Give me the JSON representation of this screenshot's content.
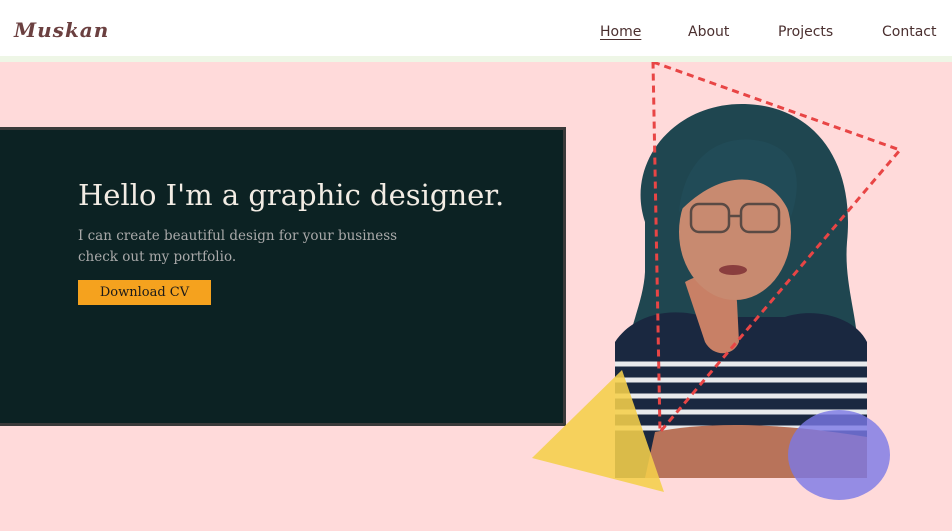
{
  "header": {
    "logo": "Muskan",
    "nav": [
      "Home",
      "About",
      "Projects",
      "Contact"
    ],
    "active_nav": "Home"
  },
  "hero": {
    "headline": "Hello I'm a graphic designer.",
    "subtitle_line1": "I can create beautiful design for your business",
    "subtitle_line2": "check out my portfolio.",
    "cta_label": "Download CV"
  },
  "colors": {
    "hero_bg": "#ffdada",
    "panel_bg": "#0c2223",
    "cta_bg": "#f5a21e",
    "triangle_yellow": "#f5cf4a",
    "circle_blue": "#7a78e6",
    "dash_red": "#e84545"
  }
}
